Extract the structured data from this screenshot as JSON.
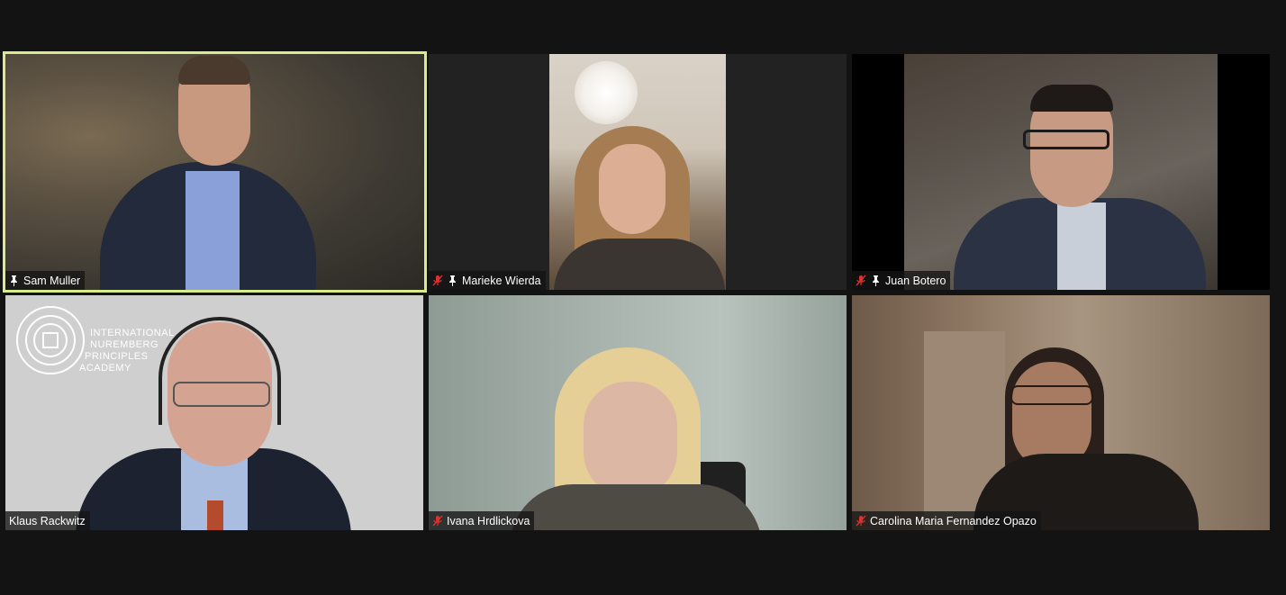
{
  "window": {
    "background": "#131313",
    "active_speaker_color": "#d8ec8c"
  },
  "participants": [
    {
      "name": "Sam Muller",
      "muted": false,
      "pinned": true,
      "active_speaker": true
    },
    {
      "name": "Marieke Wierda",
      "muted": true,
      "pinned": true,
      "active_speaker": false
    },
    {
      "name": "Juan Botero",
      "muted": true,
      "pinned": true,
      "active_speaker": false
    },
    {
      "name": "Klaus Rackwitz",
      "muted": false,
      "pinned": false,
      "active_speaker": false,
      "background_logo": {
        "lines": [
          "INTERNATIONAL",
          "NUREMBERG",
          "PRINCIPLES",
          "ACADEMY"
        ]
      }
    },
    {
      "name": "Ivana Hrdlickova",
      "muted": true,
      "pinned": false,
      "active_speaker": false
    },
    {
      "name": "Carolina Maria Fernandez Opazo",
      "muted": true,
      "pinned": false,
      "active_speaker": false
    }
  ],
  "icons": {
    "muted": "mic-muted-icon",
    "pinned": "pin-icon"
  }
}
